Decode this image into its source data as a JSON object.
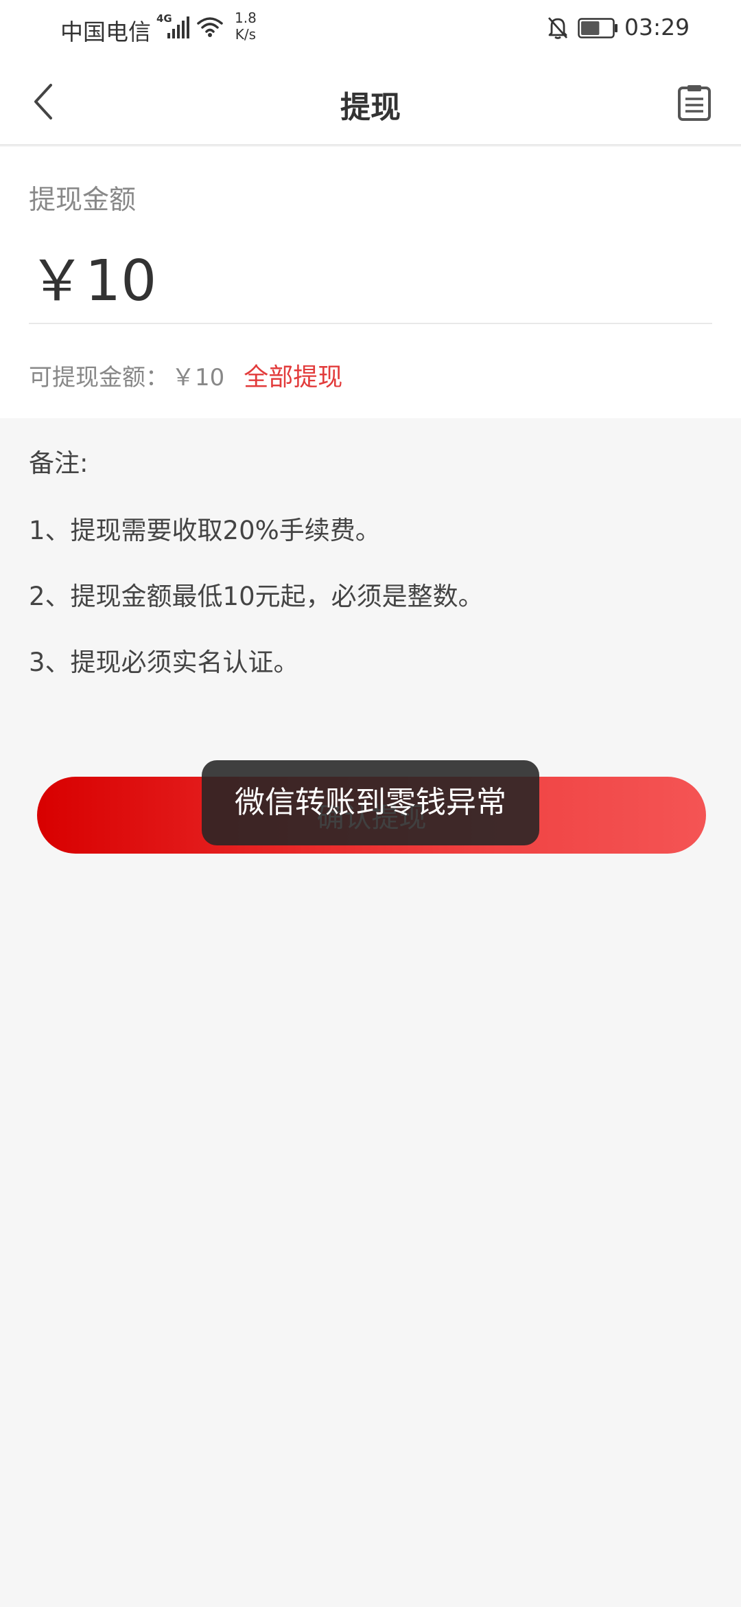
{
  "status_bar": {
    "carrier": "中国电信",
    "network": "4G",
    "speed_value": "1.8",
    "speed_unit": "K/s",
    "time": "03:29",
    "battery_level": 0.6
  },
  "nav": {
    "title": "提现"
  },
  "amount": {
    "label": "提现金额",
    "value": "￥10"
  },
  "available": {
    "label": "可提现金额：",
    "value": "￥10",
    "withdraw_all_label": "全部提现"
  },
  "notes": {
    "title": "备注:",
    "items": [
      "1、提现需要收取20%手续费。",
      "2、提现金额最低10元起，必须是整数。",
      "3、提现必须实名认证。"
    ]
  },
  "confirm_button_label": "确认提现",
  "toast": {
    "message": "微信转账到零钱异常"
  },
  "colors": {
    "accent": "#e23b3b",
    "button_start": "#d80000",
    "button_end": "#f45454"
  },
  "icons": {
    "back": "chevron-left-icon",
    "record": "clipboard-list-icon",
    "signal": "signal-icon",
    "wifi": "wifi-icon",
    "mute": "bell-off-icon",
    "battery": "battery-icon"
  }
}
